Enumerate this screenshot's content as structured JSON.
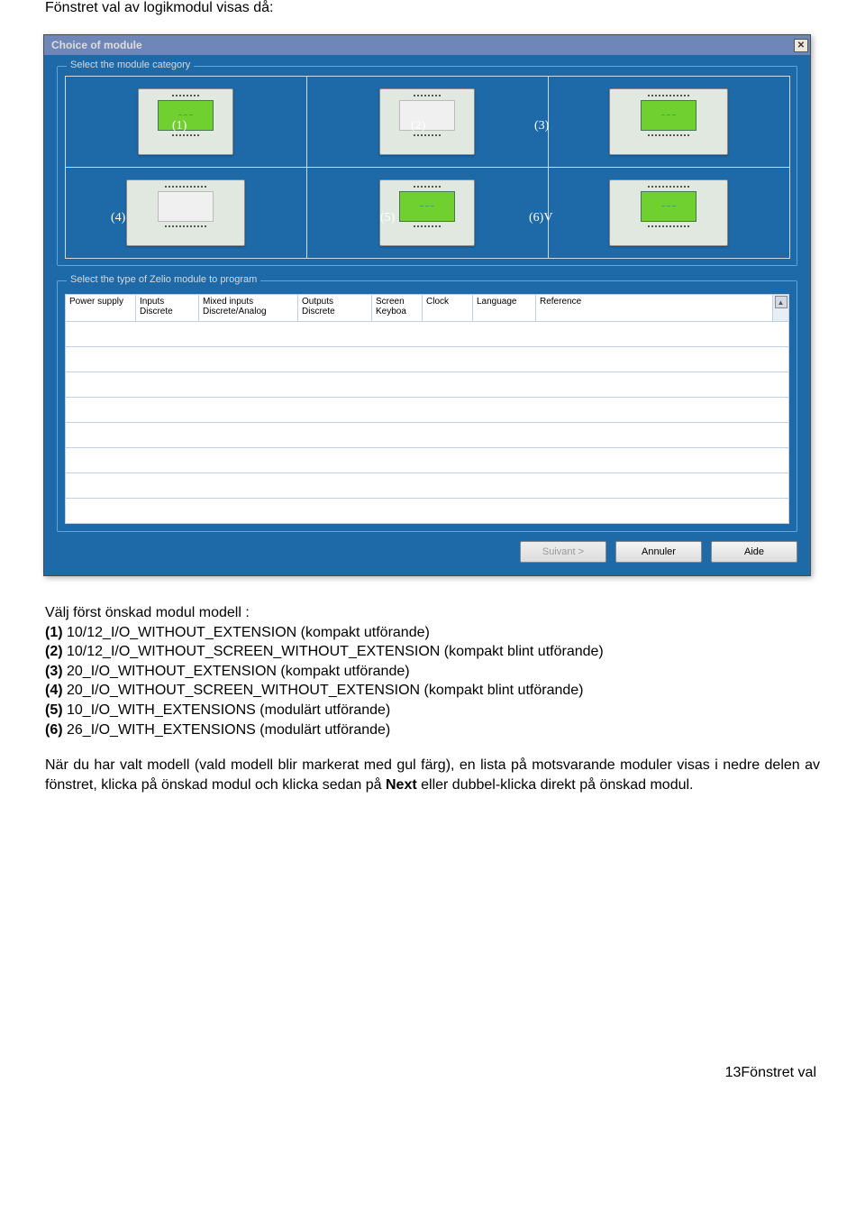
{
  "intro": "Fönstret val av logikmodul visas då:",
  "dialog": {
    "title": "Choice of module",
    "close_icon": "✕",
    "group1_label": "Select the module category",
    "group2_label": "Select the type of Zelio module to program",
    "overlays": {
      "o1": "(1)",
      "o2": "(2)",
      "o3": "(3)",
      "o4": "(4)",
      "o5": "(5)",
      "o6": "(6)V"
    },
    "table_headers": {
      "h1": "Power supply",
      "h2": "Inputs Discrete",
      "h3": "Mixed inputs Discrete/Analog",
      "h4": "Outputs Discrete",
      "h5": "Screen Keyboa",
      "h6": "Clock",
      "h7": "Language",
      "h8": "Reference"
    },
    "buttons": {
      "next": "Suivant >",
      "cancel": "Annuler",
      "help": "Aide"
    }
  },
  "legend": {
    "title": "Välj först önskad modul modell :",
    "items": [
      {
        "n": "(1)",
        "t": " 10/12_I/O_WITHOUT_EXTENSION (kompakt utförande)"
      },
      {
        "n": "(2)",
        "t": " 10/12_I/O_WITHOUT_SCREEN_WITHOUT_EXTENSION (kompakt blint utförande)"
      },
      {
        "n": "(3)",
        "t": " 20_I/O_WITHOUT_EXTENSION (kompakt utförande)"
      },
      {
        "n": "(4)",
        "t": " 20_I/O_WITHOUT_SCREEN_WITHOUT_EXTENSION (kompakt blint utförande)"
      },
      {
        "n": "(5)",
        "t": " 10_I/O_WITH_EXTENSIONS (modulärt utförande)"
      },
      {
        "n": "(6)",
        "t": " 26_I/O_WITH_EXTENSIONS (modulärt utförande)"
      }
    ]
  },
  "para_parts": {
    "p1": "När du har valt modell (vald modell blir markerat med gul färg), en lista på motsvarande moduler visas i nedre delen av fönstret, klicka på önskad modul och klicka sedan på ",
    "p2": "Next",
    "p3": " eller dubbel-klicka direkt på önskad modul."
  },
  "footer": "13Fönstret val"
}
